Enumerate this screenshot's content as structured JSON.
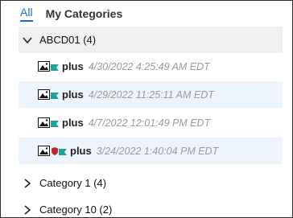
{
  "tabs": [
    {
      "label": "All",
      "active": true
    },
    {
      "label": "My Categories",
      "active": false
    }
  ],
  "groups": [
    {
      "label": "ABCD01 (4)",
      "expanded": true,
      "items": [
        {
          "name": "plus",
          "date": "4/30/2022 4:25:49 AM EDT",
          "icons": [
            "image-icon",
            "flag-icon"
          ]
        },
        {
          "name": "plus",
          "date": "4/29/2022 11:25:11 AM EDT",
          "icons": [
            "image-icon",
            "flag-icon"
          ]
        },
        {
          "name": "plus",
          "date": "4/7/2022 12:01:49 PM EDT",
          "icons": [
            "image-icon",
            "flag-icon"
          ]
        },
        {
          "name": "plus",
          "date": "3/24/2022 1:40:04 PM EDT",
          "icons": [
            "image-icon",
            "shield-icon",
            "flag-icon"
          ]
        }
      ]
    },
    {
      "label": "Category 1 (4)",
      "expanded": false
    },
    {
      "label": "Category 10 (2)",
      "expanded": false
    }
  ],
  "colors": {
    "accent": "#1a73c8",
    "flag": "#1aa39a",
    "shield": "#c0262d",
    "selected_row": "#eef4fb",
    "expanded_row": "#f0f0f0"
  }
}
